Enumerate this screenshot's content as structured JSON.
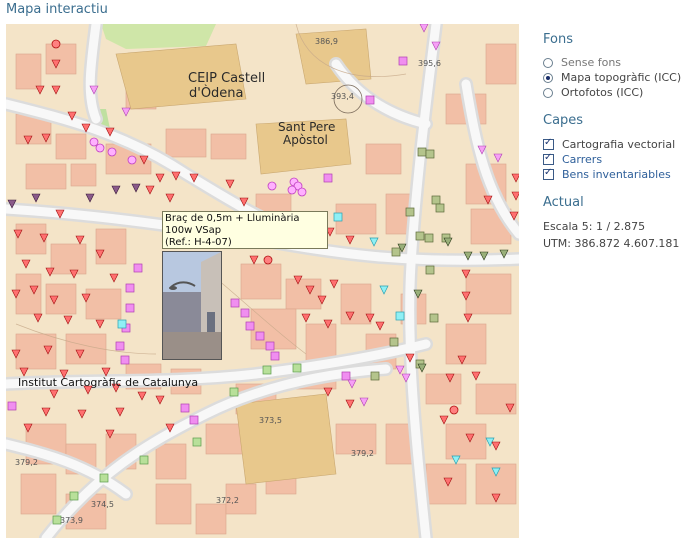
{
  "title": "Mapa interactiu",
  "map": {
    "labels": {
      "school": "CEIP Castell",
      "school2": "d'Òdena",
      "church": "Sant Pere",
      "church2": "Apòstol",
      "institute": "Institut Cartogràfic de Catalunya",
      "height1": "386,9",
      "height2": "395,6",
      "height3": "393,4",
      "height4": "379,2",
      "height5": "373,5",
      "height6": "379,2",
      "height7": "374,5",
      "height8": "372,2",
      "height9": "373,9"
    },
    "tooltip": {
      "line1": "Braç de 0,5m + Lluminària",
      "line2": "100w VSap",
      "line3": "(Ref.: H-4-07)"
    }
  },
  "sidebar": {
    "fons": {
      "heading": "Fons",
      "options": [
        "Sense fons",
        "Mapa topogràfic (ICC)",
        "Ortofotos (ICC)"
      ],
      "selected": "Mapa topogràfic (ICC)"
    },
    "capes": {
      "heading": "Capes",
      "layers": [
        "Cartografia vectorial",
        "Carrers",
        "Bens inventariables"
      ]
    },
    "actual": {
      "heading": "Actual",
      "scale": "Escala 5: 1 / 2.875",
      "utm": "UTM: 386.872 4.607.181"
    }
  },
  "colors": {
    "accent": "#3b6e8f",
    "streetlight": "#e02030",
    "pink_marker": "#e060e0",
    "green_marker": "#8fa878",
    "cyan_marker": "#40d0e0"
  }
}
